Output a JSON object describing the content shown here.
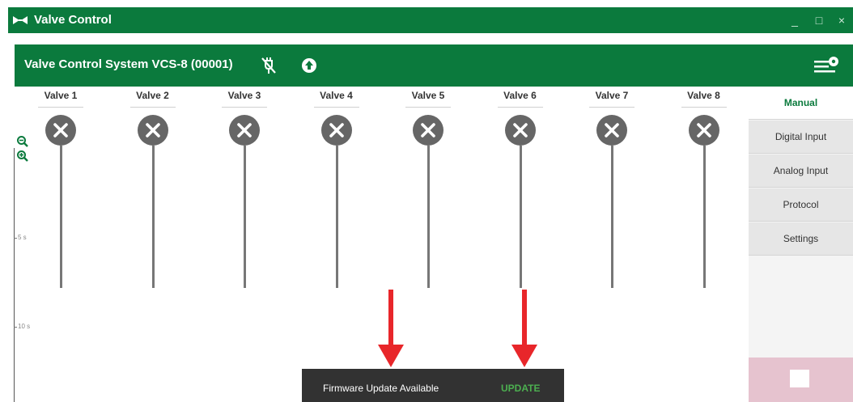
{
  "window": {
    "title": "Valve Control",
    "minimize": "_",
    "maximize": "□",
    "close": "×"
  },
  "header": {
    "title": "Valve Control System VCS-8 (00001)",
    "icons": [
      "plug-off-icon",
      "upload-circle-icon",
      "menu-settings-icon"
    ]
  },
  "valves": [
    {
      "label": "Valve 1",
      "state": "closed"
    },
    {
      "label": "Valve 2",
      "state": "closed"
    },
    {
      "label": "Valve 3",
      "state": "closed"
    },
    {
      "label": "Valve 4",
      "state": "closed"
    },
    {
      "label": "Valve 5",
      "state": "closed"
    },
    {
      "label": "Valve 6",
      "state": "closed"
    },
    {
      "label": "Valve 7",
      "state": "closed"
    },
    {
      "label": "Valve 8",
      "state": "closed"
    }
  ],
  "timeline": {
    "ticks": [
      "5 s",
      "10 s"
    ],
    "zoom_icons": [
      "zoom-out-icon",
      "zoom-in-icon"
    ]
  },
  "sidenav": {
    "tabs": [
      {
        "label": "Manual",
        "active": true
      },
      {
        "label": "Digital Input",
        "active": false
      },
      {
        "label": "Analog Input",
        "active": false
      },
      {
        "label": "Protocol",
        "active": false
      },
      {
        "label": "Settings",
        "active": false
      }
    ],
    "stop_icon": "stop-icon"
  },
  "snackbar": {
    "message": "Firmware Update Available",
    "action": "UPDATE"
  },
  "colors": {
    "brand": "#0b7a3d",
    "valve": "#666666",
    "snackbar_bg": "#323232",
    "snackbar_action": "#4caf50",
    "stop_panel": "#e6c3cf",
    "arrow": "#e8262a"
  }
}
